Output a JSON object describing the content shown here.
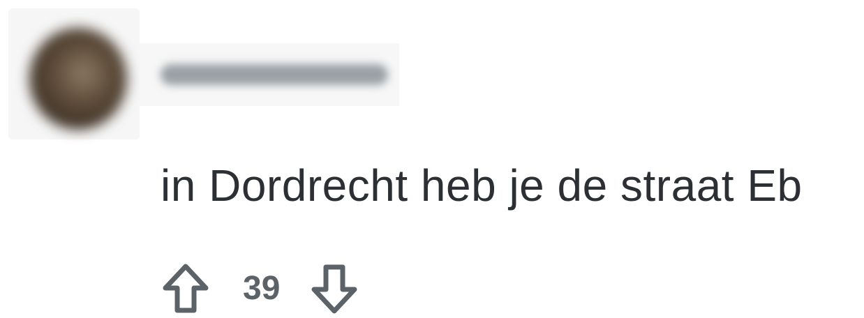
{
  "comment": {
    "avatar_icon": "user-avatar-blurred",
    "username": "",
    "body": "in Dordrecht heb je de straat Eb",
    "score": "39",
    "upvote_icon": "upvote-arrow-icon",
    "downvote_icon": "downvote-arrow-icon",
    "colors": {
      "text": "#2c3034",
      "icon": "#5b6268",
      "background": "#ffffff"
    }
  }
}
